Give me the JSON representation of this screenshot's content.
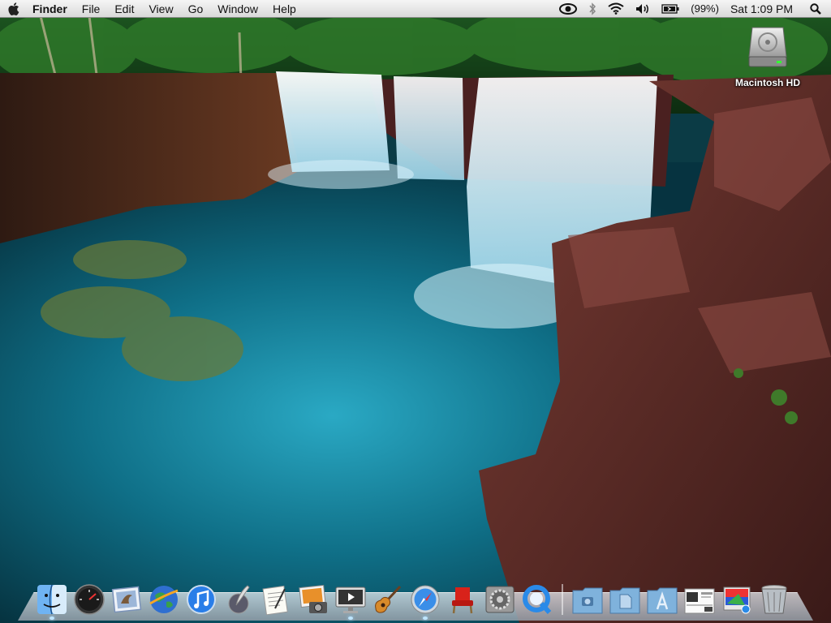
{
  "menubar": {
    "apple_icon": "apple-icon",
    "app_name": "Finder",
    "menus": [
      "File",
      "Edit",
      "View",
      "Go",
      "Window",
      "Help"
    ],
    "status": {
      "battery_percent": "(99%)",
      "clock": "Sat 1:09 PM"
    }
  },
  "desktop": {
    "icons": [
      {
        "label": "Macintosh HD",
        "icon": "hard-drive-icon"
      }
    ]
  },
  "dock": {
    "items": [
      {
        "name": "Finder",
        "icon": "finder-icon",
        "running": true
      },
      {
        "name": "Dashboard",
        "icon": "dashboard-icon",
        "running": false
      },
      {
        "name": "Mail",
        "icon": "mail-icon",
        "running": false
      },
      {
        "name": "Internet Explorer",
        "icon": "globe-icon",
        "running": false
      },
      {
        "name": "iTunes",
        "icon": "itunes-icon",
        "running": false
      },
      {
        "name": "Script Editor",
        "icon": "quill-icon",
        "running": false
      },
      {
        "name": "TextEdit",
        "icon": "textedit-icon",
        "running": false
      },
      {
        "name": "iPhoto",
        "icon": "iphoto-icon",
        "running": false
      },
      {
        "name": "Front Row",
        "icon": "frontrow-icon",
        "running": true
      },
      {
        "name": "GarageBand",
        "icon": "guitar-icon",
        "running": false
      },
      {
        "name": "Safari",
        "icon": "safari-icon",
        "running": true
      },
      {
        "name": "Chair",
        "icon": "chair-icon",
        "running": false
      },
      {
        "name": "System Preferences",
        "icon": "system-preferences-icon",
        "running": false
      },
      {
        "name": "QuickTime",
        "icon": "quicktime-icon",
        "running": false
      },
      {
        "name": "Pictures",
        "icon": "pictures-folder-icon",
        "running": false
      },
      {
        "name": "Documents",
        "icon": "documents-folder-icon",
        "running": false
      },
      {
        "name": "Applications",
        "icon": "applications-folder-icon",
        "running": false
      },
      {
        "name": "Preview",
        "icon": "preview-icon",
        "running": false
      },
      {
        "name": "Stack",
        "icon": "stack-icon",
        "running": false
      },
      {
        "name": "Trash",
        "icon": "trash-icon",
        "running": false
      }
    ]
  },
  "colors": {
    "menubar_top": "#f5f5f5",
    "menubar_bottom": "#d9d9d9",
    "water": "#0e6f86",
    "rock": "#5a2a26"
  }
}
